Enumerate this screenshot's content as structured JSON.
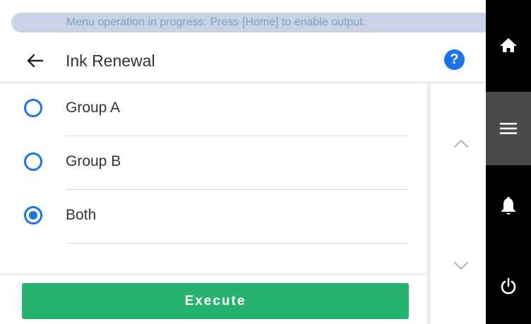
{
  "banner": {
    "text": "Menu operation in progress: Press [Home] to enable output."
  },
  "header": {
    "title": "Ink Renewal",
    "help_glyph": "?"
  },
  "options": [
    {
      "label": "Group A",
      "selected": false
    },
    {
      "label": "Group B",
      "selected": false
    },
    {
      "label": "Both",
      "selected": true
    }
  ],
  "actions": {
    "execute_label": "Execute"
  },
  "icons": {
    "back": "arrow-left-icon",
    "help": "help-circle-icon",
    "scroll_up": "chevron-up-icon",
    "scroll_down": "chevron-down-icon",
    "home": "home-icon",
    "menu": "menu-icon",
    "notifications": "bell-icon",
    "power": "power-icon"
  },
  "colors": {
    "accent": "#1a73e8",
    "execute": "#26b36f",
    "banner_bg": "#c9d3e6",
    "rail_bg": "#000000",
    "rail_active": "#4a4a4a"
  }
}
